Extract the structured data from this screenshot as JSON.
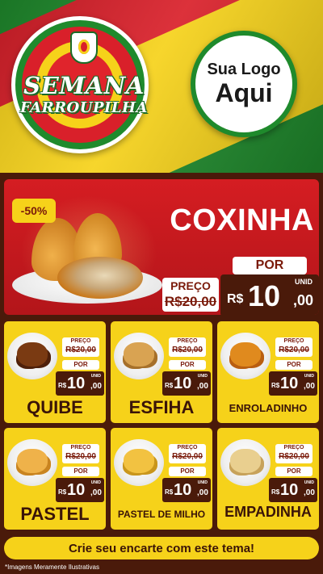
{
  "header": {
    "event_title_line1": "SEMANA",
    "event_title_line2": "FARROUPILHA",
    "logo_line1": "Sua Logo",
    "logo_line2": "Aqui"
  },
  "featured": {
    "discount": "-50%",
    "name": "COXINHA",
    "por_label": "POR",
    "old_label": "PREÇO",
    "old_price": "R$20,00",
    "currency": "R$",
    "unit_label": "UNID",
    "price_int": "10",
    "price_dec": ",00"
  },
  "products": [
    {
      "name": "QUIBE",
      "old_label": "PREÇO",
      "old_price": "R$20,00",
      "por_label": "POR",
      "currency": "R$",
      "unit_label": "UNID",
      "price_int": "10",
      "price_dec": ",00"
    },
    {
      "name": "ESFIHA",
      "old_label": "PREÇO",
      "old_price": "R$20,00",
      "por_label": "POR",
      "currency": "R$",
      "unit_label": "UNID",
      "price_int": "10",
      "price_dec": ",00"
    },
    {
      "name": "ENROLADINHO",
      "old_label": "PREÇO",
      "old_price": "R$20,00",
      "por_label": "POR",
      "currency": "R$",
      "unit_label": "UNID",
      "price_int": "10",
      "price_dec": ",00"
    },
    {
      "name": "PASTEL",
      "old_label": "PREÇO",
      "old_price": "R$20,00",
      "por_label": "POR",
      "currency": "R$",
      "unit_label": "UNID",
      "price_int": "10",
      "price_dec": ",00"
    },
    {
      "name": "PASTEL DE MILHO",
      "old_label": "PREÇO",
      "old_price": "R$20,00",
      "por_label": "POR",
      "currency": "R$",
      "unit_label": "UNID",
      "price_int": "10",
      "price_dec": ",00"
    },
    {
      "name": "EMPADINHA",
      "old_label": "PREÇO",
      "old_price": "R$20,00",
      "por_label": "POR",
      "currency": "R$",
      "unit_label": "UNID",
      "price_int": "10",
      "price_dec": ",00"
    }
  ],
  "footer": {
    "cta": "Crie seu encarte com este tema!",
    "disclaimer": "*Imagens Meramente Ilustrativas"
  },
  "colors": {
    "flag_green": "#1f8a2c",
    "flag_red": "#d9202a",
    "flag_yellow": "#f6d21a",
    "board_brown": "#4a1a0a"
  }
}
